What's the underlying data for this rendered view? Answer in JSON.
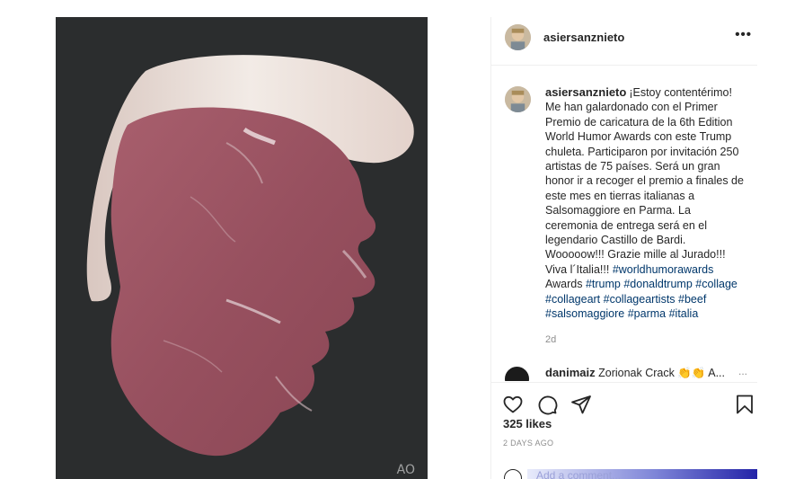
{
  "post": {
    "username": "asiersanznieto",
    "more_label": "•••",
    "watermark": "AO",
    "caption": {
      "username": "asiersanznieto",
      "text": "¡Estoy contentérimo! Me han galardonado con el Primer Premio de caricatura de la 6th Edition World Humor Awards con este Trump chuleta. Participaron por invitación 250 artistas de 75 países. Será un gran honor ir a recoger el premio a finales de este mes en tierras italianas a Salsomaggiore en Parma. La ceremonia de entrega será en el legendario Castillo de Bardi. Wooooow!!! Grazie mille al Jurado!!! Viva l´Italia!!! ",
      "tags": [
        "#worldhumorawards",
        "Awards",
        "#trump",
        "#donaldtrump",
        "#collage",
        "#collageart",
        "#collageartists",
        "#beef",
        "#salsomaggiore",
        "#parma",
        "#italia"
      ],
      "age": "2d"
    },
    "comment": {
      "username": "danimaiz",
      "text": "Zorionak Crack 👏👏 A...",
      "more": "..."
    },
    "actions": {
      "like_icon": "heart-icon",
      "comment_icon": "comment-icon",
      "share_icon": "share-icon",
      "save_icon": "bookmark-icon"
    },
    "likes": "325 likes",
    "timestamp": "2 DAYS AGO",
    "add_comment_placeholder": "Add a comment..."
  },
  "colors": {
    "background_dark": "#2b2d2e",
    "meat": "#9a5563",
    "fat": "#eadfd8",
    "link": "#00376b",
    "muted": "#8e8e8e"
  }
}
